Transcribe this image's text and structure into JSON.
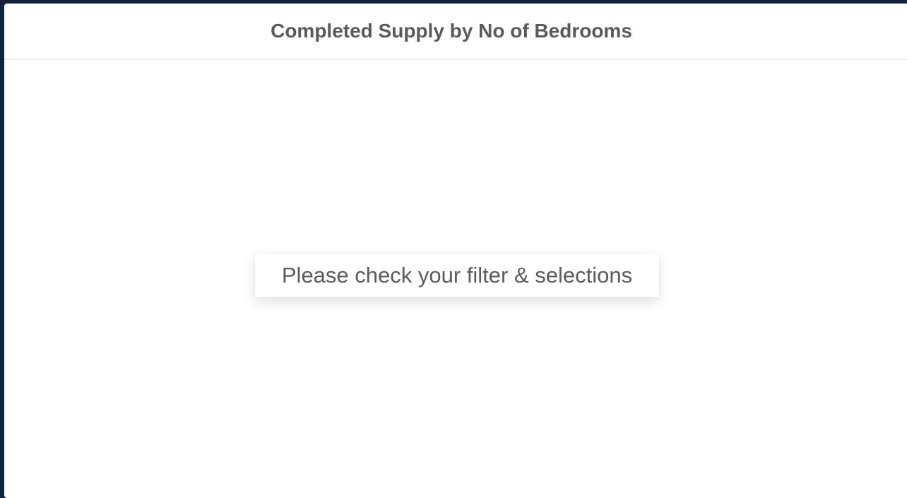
{
  "panel": {
    "title": "Completed Supply by No of Bedrooms",
    "empty_message": "Please check your filter & selections"
  }
}
